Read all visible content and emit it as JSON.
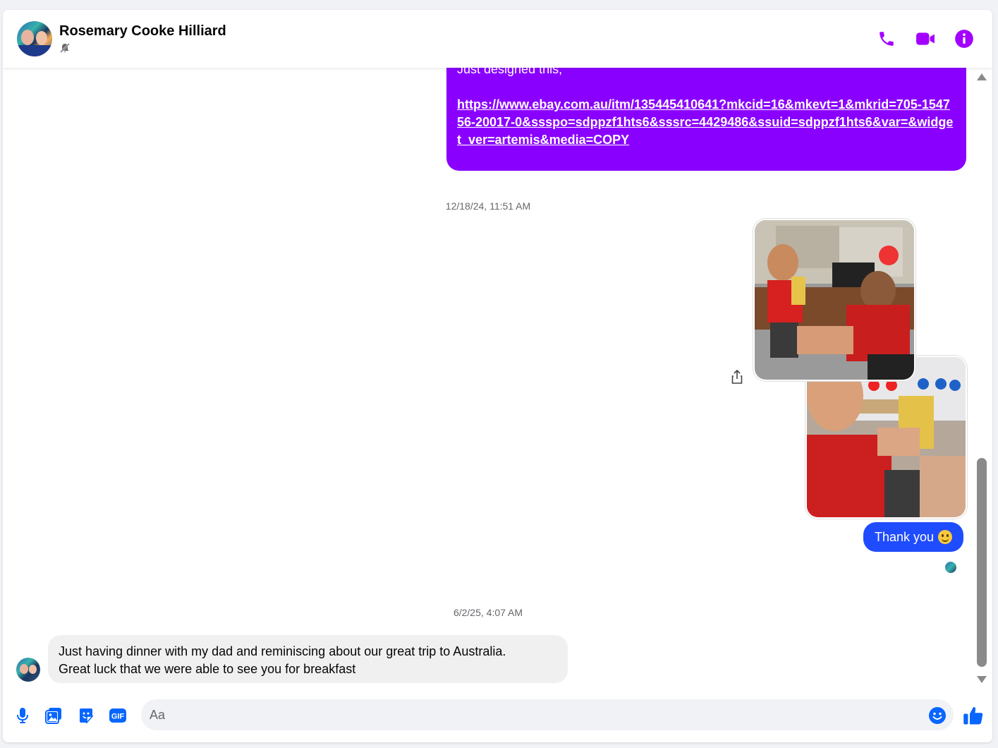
{
  "header": {
    "contact_name": "Rosemary Cooke Hilliard",
    "status_icon": "muted-bell-icon"
  },
  "thread": {
    "link_message_intro": "Just designed this,",
    "link_message_url": "https://www.ebay.com.au/itm/135445410641?mkcid=16&mkevt=1&mkrid=705-154756-20017-0&ssspo=sdppzf1hts6&sssrc=4429486&ssuid=sdppzf1hts6&var=&widget_ver=artemis&media=COPY",
    "timestamp_1": "12/18/24, 11:51 AM",
    "thanks_message": "Thank you",
    "timestamp_2": "6/2/25, 4:07 AM",
    "received_message_line1": "Just having dinner with my dad and reminiscing about our great trip to Australia.",
    "received_message_line2": "Great luck that we were able to see you for breakfast"
  },
  "composer": {
    "placeholder": "Aa"
  },
  "colors": {
    "accent_purple": "#8a00ff",
    "sent_blue": "#1f4cff",
    "icon_blue": "#0866ff",
    "header_icon_purple": "#a200ff"
  }
}
